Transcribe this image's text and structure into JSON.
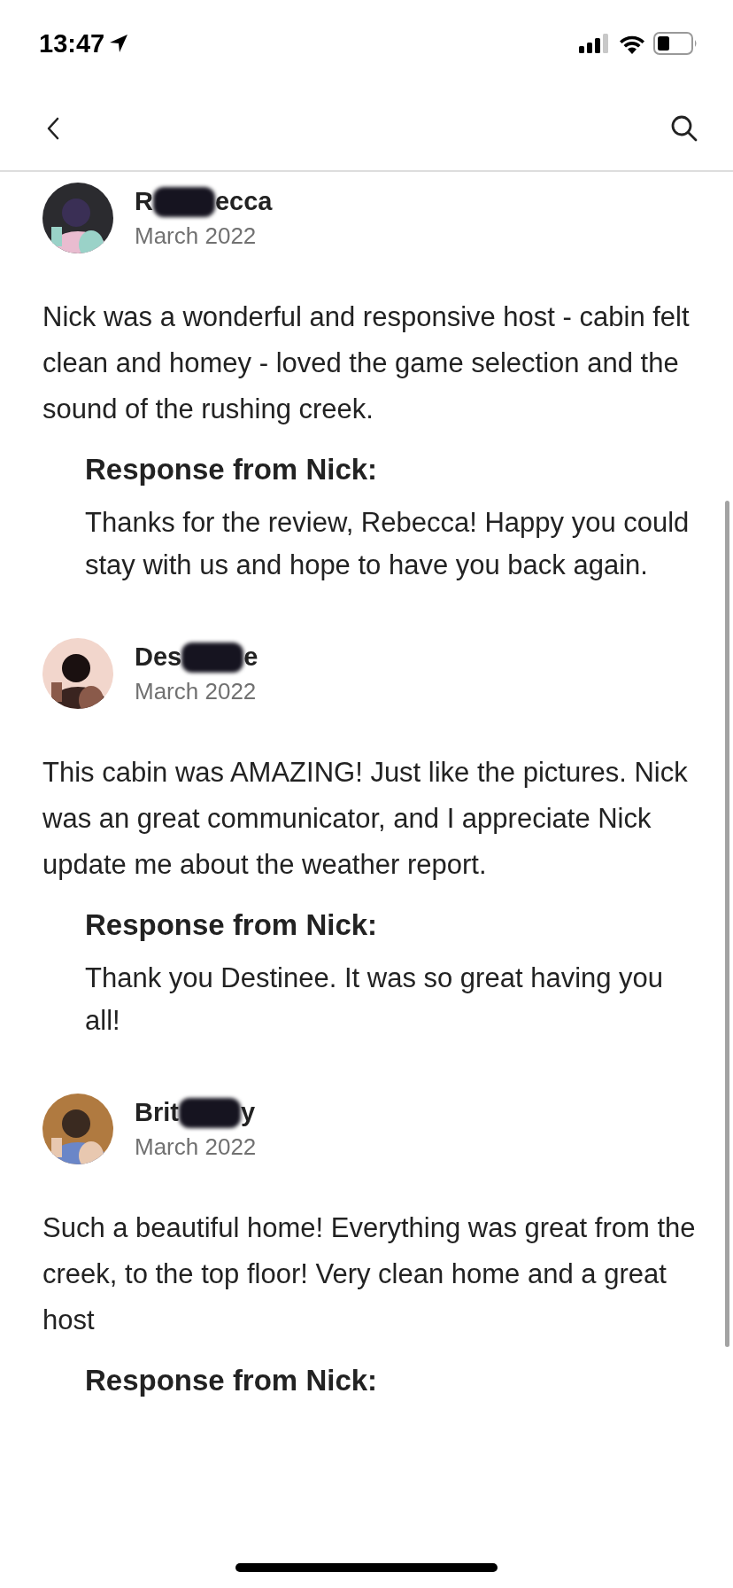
{
  "status_bar": {
    "time": "13:47"
  },
  "reviews": [
    {
      "name_parts": [
        "R",
        "ecca"
      ],
      "date": "March 2022",
      "text": "Nick was a wonderful and responsive host - cabin felt clean and homey - loved the game selection and the sound of the rushing creek.",
      "response": {
        "heading": "Response from Nick:",
        "text": "Thanks for the review, Rebecca! Happy you could stay with us and hope to have you back again."
      }
    },
    {
      "name_parts": [
        "Des",
        "e"
      ],
      "date": "March 2022",
      "text": "This cabin was AMAZING! Just like the pictures. Nick was an great communicator, and I appreciate Nick update me about the weather report.",
      "response": {
        "heading": "Response from Nick:",
        "text": "Thank you Destinee. It was so great having you all!"
      }
    },
    {
      "name_parts": [
        "Brit",
        "y"
      ],
      "date": "March 2022",
      "text": "Such a beautiful home! Everything was great from the creek, to the top floor! Very clean home and a great host",
      "response": {
        "heading": "Response from Nick:"
      }
    }
  ]
}
